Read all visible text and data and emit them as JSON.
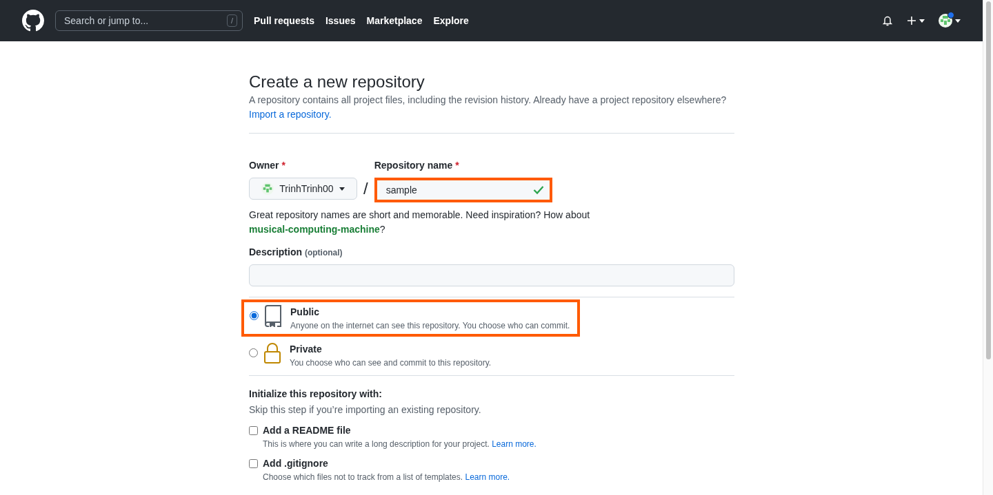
{
  "header": {
    "search": {
      "placeholder": "Search or jump to...",
      "shortcut": "/"
    },
    "nav": [
      "Pull requests",
      "Issues",
      "Marketplace",
      "Explore"
    ],
    "notifications_unread": true
  },
  "page": {
    "title": "Create a new repository",
    "intro": "A repository contains all project files, including the revision history. Already have a project repository elsewhere?",
    "import_link": "Import a repository.",
    "owner": {
      "label": "Owner",
      "required": "*",
      "value": "TrinhTrinh00"
    },
    "separator": "/",
    "repo_name": {
      "label": "Repository name",
      "required": "*",
      "value": "sample",
      "valid": true,
      "highlighted": true
    },
    "name_hint": "Great repository names are short and memorable. Need inspiration? How about",
    "suggestion": "musical-computing-machine",
    "hint_end": "?",
    "description": {
      "label": "Description",
      "optional": "(optional)"
    },
    "visibility": [
      {
        "kind": "public",
        "label": "Public",
        "text": "Anyone on the internet can see this repository. You choose who can commit.",
        "selected": true,
        "highlighted": true
      },
      {
        "kind": "private",
        "label": "Private",
        "text": "You choose who can see and commit to this repository.",
        "selected": false,
        "highlighted": false
      }
    ],
    "init_title": "Initialize this repository with:",
    "init_text": "Skip this step if you’re importing an existing repository.",
    "options": [
      {
        "label": "Add a README file",
        "text": "This is where you can write a long description for your project.",
        "link": "Learn more.",
        "checked": false
      },
      {
        "label": "Add .gitignore",
        "text": "Choose which files not to track from a list of templates.",
        "link": "Learn more.",
        "checked": false
      }
    ]
  }
}
